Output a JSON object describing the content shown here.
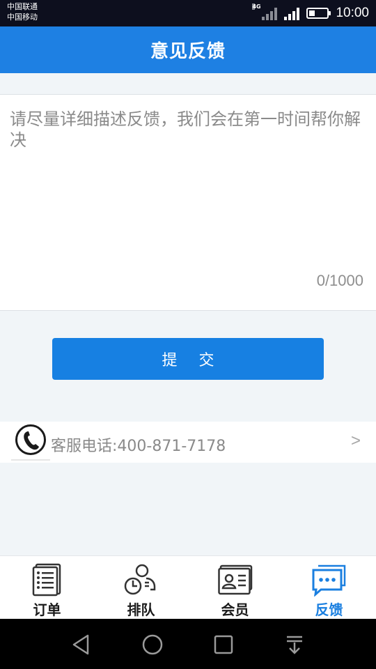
{
  "status_bar": {
    "carrier_1": "中国联通",
    "carrier_2": "中国移动",
    "network_tag": "4G",
    "time": "10:00",
    "battery_level": 0.35
  },
  "header": {
    "title": "意见反馈"
  },
  "feedback": {
    "placeholder": "请尽量详细描述反馈，我们会在第一时间帮你解决",
    "value": "",
    "char_count": "0/1000"
  },
  "submit_label": "提 交",
  "service": {
    "text": "客服电话:400-871-7178",
    "arrow": ">"
  },
  "tabs": [
    {
      "label": "订单",
      "icon": "order-list-icon",
      "active": false
    },
    {
      "label": "排队",
      "icon": "queue-icon",
      "active": false
    },
    {
      "label": "会员",
      "icon": "member-card-icon",
      "active": false
    },
    {
      "label": "反馈",
      "icon": "feedback-chat-icon",
      "active": true
    }
  ],
  "colors": {
    "brand_blue": "#1e80e3",
    "active_tab": "#1a7fe0",
    "status_bar": "#0d0f1e",
    "page_bg": "#f1f5f8"
  },
  "nav_icons": [
    "back-icon",
    "home-icon",
    "recents-icon",
    "notification-pulldown-icon"
  ]
}
